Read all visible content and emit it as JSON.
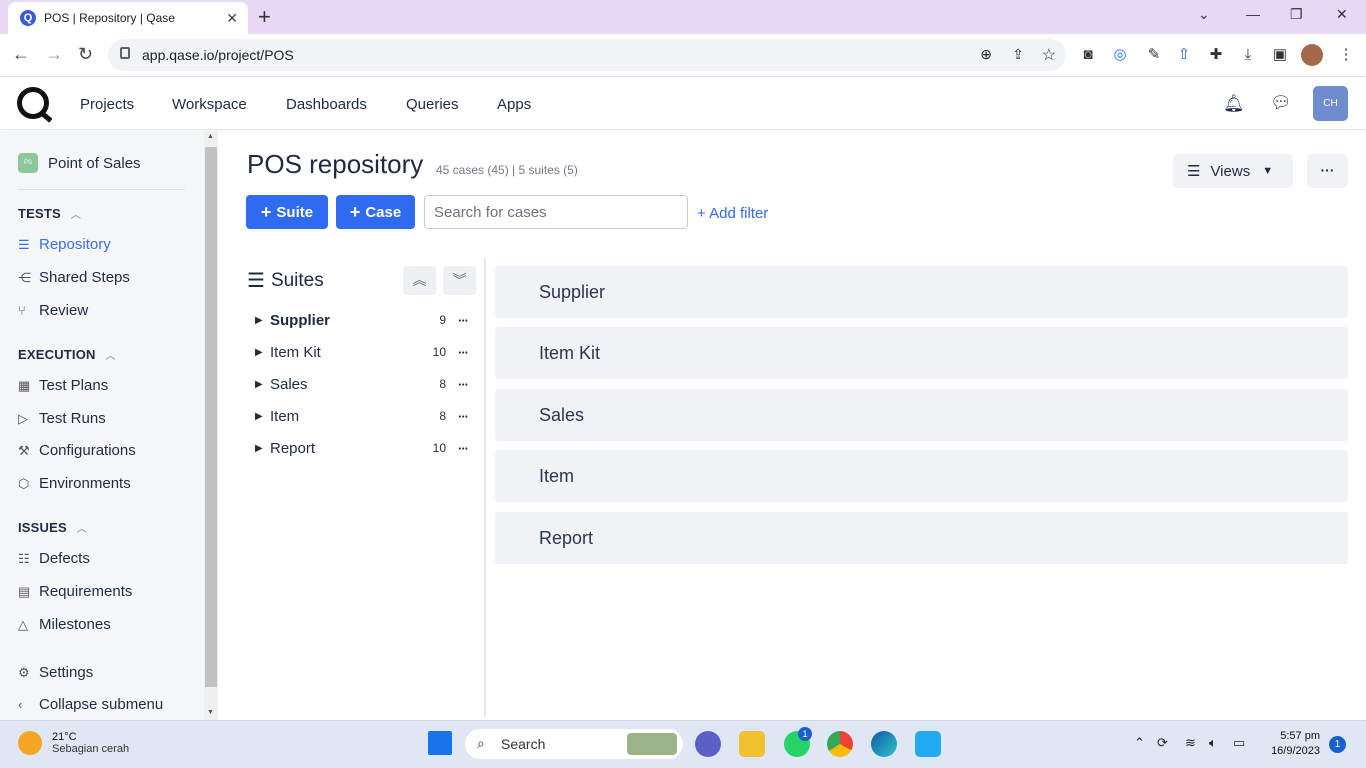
{
  "browser": {
    "tab_title": "POS | Repository | Qase",
    "url": "app.qase.io/project/POS"
  },
  "header": {
    "nav": [
      "Projects",
      "Workspace",
      "Dashboards",
      "Queries",
      "Apps"
    ],
    "avatar_initials": "CH"
  },
  "sidebar": {
    "project_badge": "PS",
    "project_name": "Point of Sales",
    "sections": {
      "tests": "TESTS",
      "execution": "EXECUTION",
      "issues": "ISSUES"
    },
    "items": {
      "repository": "Repository",
      "shared_steps": "Shared Steps",
      "review": "Review",
      "test_plans": "Test Plans",
      "test_runs": "Test Runs",
      "configurations": "Configurations",
      "environments": "Environments",
      "defects": "Defects",
      "requirements": "Requirements",
      "milestones": "Milestones",
      "settings": "Settings",
      "collapse": "Collapse submenu"
    }
  },
  "main": {
    "title": "POS repository",
    "meta": "45 cases (45) | 5 suites (5)",
    "views_label": "Views",
    "suite_button": "Suite",
    "case_button": "Case",
    "search_placeholder": "Search for cases",
    "add_filter": "+ Add filter",
    "suites_heading": "Suites",
    "suites": [
      {
        "name": "Supplier",
        "count": "9"
      },
      {
        "name": "Item Kit",
        "count": "10"
      },
      {
        "name": "Sales",
        "count": "8"
      },
      {
        "name": "Item",
        "count": "8"
      },
      {
        "name": "Report",
        "count": "10"
      }
    ]
  },
  "taskbar": {
    "temperature": "21°C",
    "weather": "Sebagian cerah",
    "search": "Search",
    "time": "5:57 pm",
    "date": "16/9/2023",
    "notifications": "1",
    "whatsapp_badge": "1"
  },
  "colors": {
    "primary": "#2f6bf0",
    "tab_bar": "#e8d7f5",
    "sidebar_bg": "#f5f6f8",
    "card_bg": "#f1f2f5"
  }
}
